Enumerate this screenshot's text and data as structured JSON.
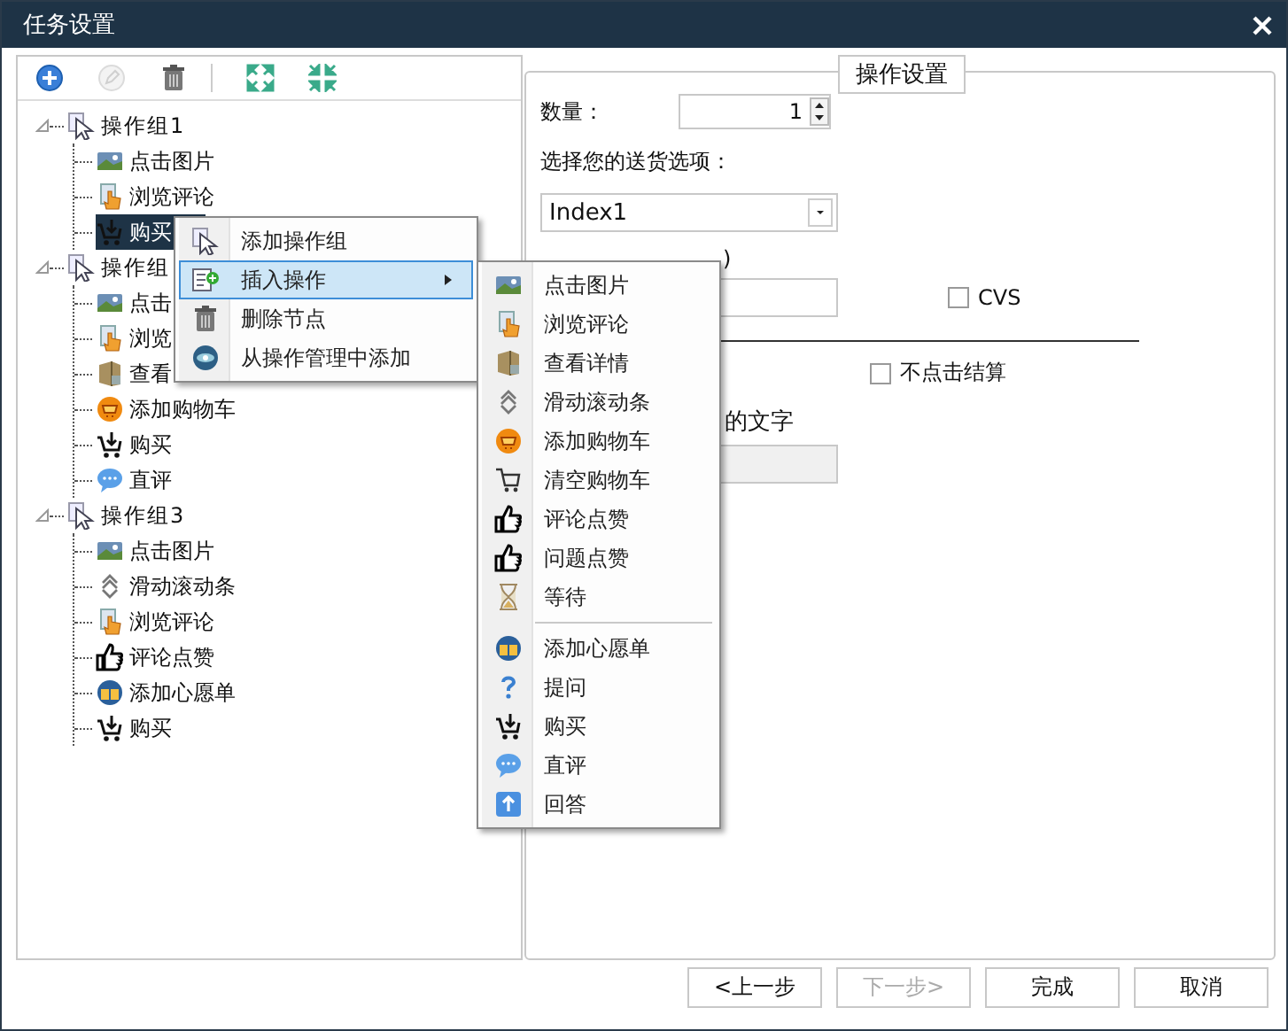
{
  "window": {
    "title": "任务设置"
  },
  "toolbar": [
    {
      "kind": "add",
      "disabled": false
    },
    {
      "kind": "edit",
      "disabled": true
    },
    {
      "kind": "delete",
      "disabled": false
    },
    {
      "kind": "expand",
      "disabled": false
    },
    {
      "kind": "collapse",
      "disabled": false
    }
  ],
  "tree": [
    {
      "label": "操作组1",
      "kind": "group",
      "expanded": true,
      "selected": false,
      "children": [
        {
          "label": "点击图片",
          "kind": "image",
          "selected": false
        },
        {
          "label": "浏览评论",
          "kind": "hand",
          "selected": false
        },
        {
          "label": "购买",
          "kind": "buy",
          "selected": true
        }
      ]
    },
    {
      "label": "操作组",
      "kind": "group",
      "expanded": true,
      "selected": false,
      "children": [
        {
          "label": "点击",
          "kind": "image",
          "selected": false
        },
        {
          "label": "浏览",
          "kind": "hand",
          "selected": false
        },
        {
          "label": "查看",
          "kind": "box",
          "selected": false
        },
        {
          "label": "添加购物车",
          "kind": "cart",
          "selected": false
        },
        {
          "label": "购买",
          "kind": "buy",
          "selected": false
        },
        {
          "label": "直评",
          "kind": "chat",
          "selected": false
        }
      ]
    },
    {
      "label": "操作组3",
      "kind": "group",
      "expanded": true,
      "selected": false,
      "children": [
        {
          "label": "点击图片",
          "kind": "image",
          "selected": false
        },
        {
          "label": "滑动滚动条",
          "kind": "scroll",
          "selected": false
        },
        {
          "label": "浏览评论",
          "kind": "hand",
          "selected": false
        },
        {
          "label": "评论点赞",
          "kind": "thumb",
          "selected": false
        },
        {
          "label": "添加心愿单",
          "kind": "wish",
          "selected": false
        },
        {
          "label": "购买",
          "kind": "buy",
          "selected": false
        }
      ]
    }
  ],
  "settings": {
    "title": "操作设置",
    "quantity": {
      "label": "数量：",
      "value": "1"
    },
    "delivery": {
      "label": "选择您的送货选项：",
      "value": "Index1"
    },
    "hidden_label": ")",
    "cvs": {
      "label": "CVS",
      "checked": false
    },
    "no_checkout": {
      "label": "不点击结算",
      "checked": false
    },
    "text_label": "的文字"
  },
  "buttons": [
    {
      "label": "<上一步",
      "disabled": false
    },
    {
      "label": "下一步>",
      "disabled": true
    },
    {
      "label": "完成",
      "disabled": false
    },
    {
      "label": "取消",
      "disabled": false
    }
  ],
  "context_menu": [
    {
      "label": "添加操作组",
      "kind": "group",
      "selected": false,
      "submenu": false
    },
    {
      "label": "插入操作",
      "kind": "insert",
      "selected": true,
      "submenu": true
    },
    {
      "label": "删除节点",
      "kind": "delete",
      "selected": false,
      "submenu": false
    },
    {
      "label": "从操作管理中添加",
      "kind": "disc",
      "selected": false,
      "submenu": false
    }
  ],
  "submenu": [
    {
      "label": "点击图片",
      "kind": "image",
      "separator_before": false
    },
    {
      "label": "浏览评论",
      "kind": "hand",
      "separator_before": false
    },
    {
      "label": "查看详情",
      "kind": "box",
      "separator_before": false
    },
    {
      "label": "滑动滚动条",
      "kind": "scroll",
      "separator_before": false
    },
    {
      "label": "添加购物车",
      "kind": "cart",
      "separator_before": false
    },
    {
      "label": "清空购物车",
      "kind": "emptycart",
      "separator_before": false
    },
    {
      "label": "评论点赞",
      "kind": "thumb",
      "separator_before": false
    },
    {
      "label": "问题点赞",
      "kind": "thumb",
      "separator_before": false
    },
    {
      "label": "等待",
      "kind": "wait",
      "separator_before": false
    },
    {
      "label": "添加心愿单",
      "kind": "wish",
      "separator_before": true
    },
    {
      "label": "提问",
      "kind": "question",
      "separator_before": false
    },
    {
      "label": "购买",
      "kind": "buy",
      "separator_before": false
    },
    {
      "label": "直评",
      "kind": "chat",
      "separator_before": false
    },
    {
      "label": "回答",
      "kind": "answer",
      "separator_before": false
    }
  ]
}
